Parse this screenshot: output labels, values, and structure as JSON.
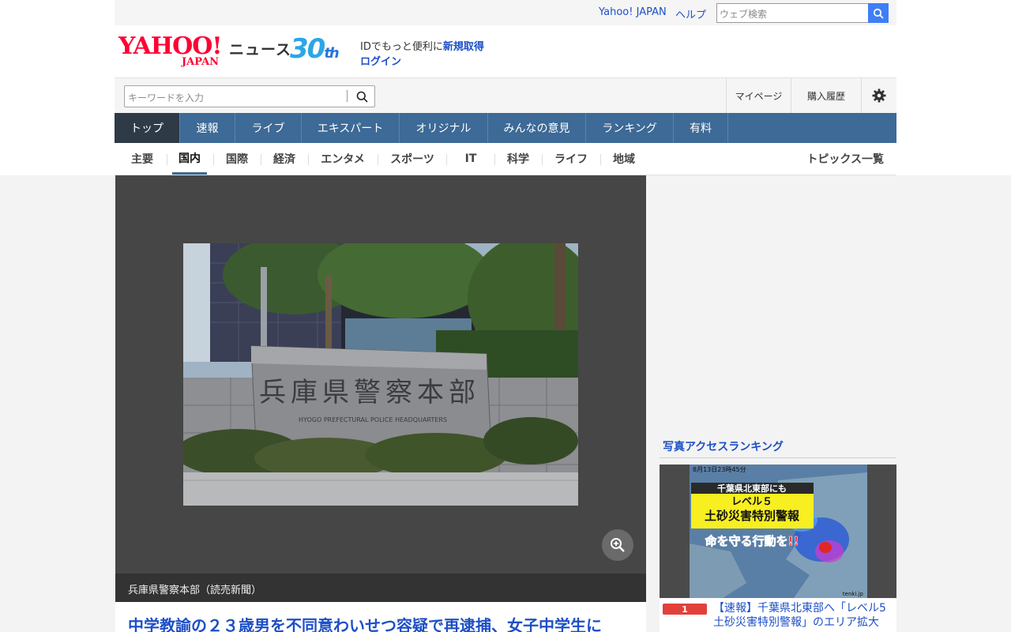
{
  "util_bar": {
    "yahoo_japan_link": "Yahoo! JAPAN",
    "help_link": "ヘルプ",
    "web_search_placeholder": "ウェブ検索"
  },
  "header": {
    "logo_word": "YAHOO!",
    "logo_sub": "JAPAN",
    "section_title": "ニュース",
    "anniversary_num": "30",
    "anniversary_suffix": "th",
    "id_promo": "IDでもっと便利に",
    "new_signup": "新規取得",
    "login": "ログイン"
  },
  "search": {
    "placeholder": "キーワードを入力",
    "mypage": "マイページ",
    "purchase_history": "購入履歴"
  },
  "main_nav": [
    "トップ",
    "速報",
    "ライブ",
    "エキスパート",
    "オリジナル",
    "みんなの意見",
    "ランキング",
    "有料"
  ],
  "sub_nav": [
    "主要",
    "国内",
    "国際",
    "経済",
    "エンタメ",
    "スポーツ",
    "IT",
    "科学",
    "ライフ",
    "地域"
  ],
  "topics_link": "トピックス一覧",
  "viewer": {
    "caption": "兵庫県警察本部（読売新聞）",
    "sign_text": "兵庫県警察本部",
    "sign_sub": "HYOGO PREFECTURAL POLICE HEADQUARTERS"
  },
  "article": {
    "title": "中学教諭の２３歳男を不同意わいせつ容疑で再逮捕、女子中学生に"
  },
  "ranking": {
    "heading": "写真アクセスランキング",
    "image_timestamp": "8月13日23時45分",
    "image_line1": "千葉県北東部にも",
    "image_line2": "レベル５",
    "image_line3": "土砂災害特別警報",
    "image_line4": "命を守る行動を!!",
    "image_credit": "tenki.jp",
    "items": [
      {
        "rank": "1",
        "text": "【速報】千葉県北東部へ「レベル5土砂災害特別警報」のエリア拡大"
      }
    ]
  },
  "colors": {
    "nav": "#3d6a96",
    "nav_active": "#2e3a46",
    "link": "#1d4fc6",
    "yahoo_red": "#ff0033",
    "rank_badge": "#e2403a"
  }
}
